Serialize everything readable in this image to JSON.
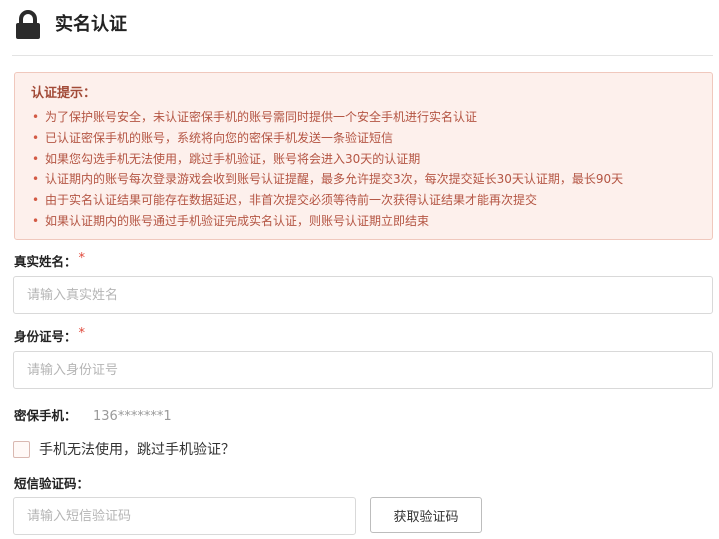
{
  "header": {
    "icon": "lock-icon",
    "title": "实名认证"
  },
  "notice": {
    "title": "认证提示：",
    "items": [
      "为了保护账号安全，未认证密保手机的账号需同时提供一个安全手机进行实名认证",
      "已认证密保手机的账号，系统将向您的密保手机发送一条验证短信",
      "如果您勾选手机无法使用，跳过手机验证，账号将会进入30天的认证期",
      "认证期内的账号每次登录游戏会收到账号认证提醒，最多允许提交3次，每次提交延长30天认证期，最长90天",
      "由于实名认证结果可能存在数据延迟，非首次提交必须等待前一次获得认证结果才能再次提交",
      "如果认证期内的账号通过手机验证完成实名认证，则账号认证期立即结束"
    ]
  },
  "form": {
    "required_mark": "*",
    "real_name": {
      "label": "真实姓名：",
      "placeholder": "请输入真实姓名",
      "value": ""
    },
    "id_number": {
      "label": "身份证号：",
      "placeholder": "请输入身份证号",
      "value": ""
    },
    "secure_phone": {
      "label": "密保手机：",
      "value": "136*******1"
    },
    "skip_phone": {
      "label": "手机无法使用，跳过手机验证？",
      "checked": false
    },
    "sms_code": {
      "label": "短信验证码：",
      "placeholder": "请输入短信验证码",
      "value": ""
    },
    "get_code_button": "获取验证码"
  },
  "colors": {
    "notice_bg": "#fdf0ec",
    "notice_border": "#f0c8bd",
    "notice_text": "#b45543",
    "required": "#e0483a"
  }
}
